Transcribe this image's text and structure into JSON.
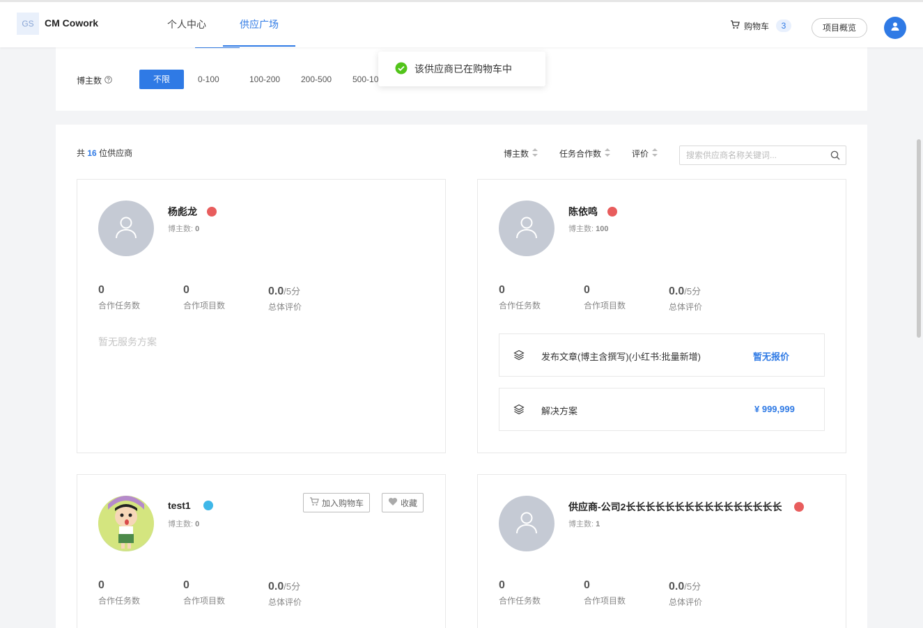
{
  "header": {
    "logo_text": "GS",
    "app_name": "CM Cowork",
    "tabs": [
      "个人中心",
      "供应广场"
    ],
    "active_tab": "供应广场",
    "cart_label": "购物车",
    "cart_count": "3",
    "overview_label": "项目概览"
  },
  "filter": {
    "label": "博主数",
    "options": [
      "不限",
      "0-100",
      "100-200",
      "200-500",
      "500-10"
    ],
    "selected": "不限"
  },
  "toast": {
    "message": "该供应商已在购物车中",
    "status_color": "#52c41a"
  },
  "list": {
    "total_prefix": "共",
    "total_count": "16",
    "total_suffix": "位供应商",
    "sorters": [
      "博主数",
      "任务合作数",
      "评价"
    ],
    "search_placeholder": "搜索供应商名称关键词..."
  },
  "stat_labels": {
    "tasks": "合作任务数",
    "projects": "合作项目数",
    "rating": "总体评价",
    "rating_unit": "/5分"
  },
  "cards": [
    {
      "name": "杨彪龙",
      "bloggers_label": "博主数:",
      "bloggers": "0",
      "tasks": "0",
      "projects": "0",
      "rating": "0.0",
      "no_plan": "暂无服务方案",
      "badge_color": "#e85d5d"
    },
    {
      "name": "陈依鸣",
      "bloggers_label": "博主数:",
      "bloggers": "100",
      "tasks": "0",
      "projects": "0",
      "rating": "0.0",
      "badge_color": "#e85d5d",
      "plans": [
        {
          "name": "发布文章(博主含撰写)(小红书:批量新增)",
          "price": "暂无报价"
        },
        {
          "name": "解决方案",
          "price": "¥ 999,999"
        }
      ]
    },
    {
      "name": "test1",
      "bloggers_label": "博主数:",
      "bloggers": "0",
      "tasks": "0",
      "projects": "0",
      "rating": "0.0",
      "badge_color": "#3fb7e8",
      "add_cart_label": "加入购物车",
      "favorite_label": "收藏"
    },
    {
      "name": "供应商-公司2长长长长长长长长长长长长长长长长",
      "bloggers_label": "博主数:",
      "bloggers": "1",
      "tasks": "0",
      "projects": "0",
      "rating": "0.0",
      "badge_color": "#e85d5d"
    }
  ],
  "colors": {
    "accent": "#2f7ae5",
    "avatar_bg": "#c5cad4"
  }
}
